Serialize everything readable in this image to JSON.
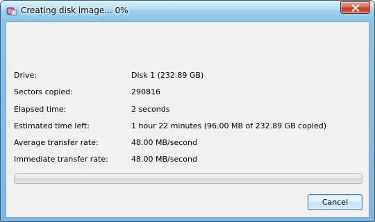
{
  "window": {
    "title": "Creating disk image... 0%",
    "title_icon": "disk-image-app-icon",
    "close_icon": "close-x-icon"
  },
  "details": [
    {
      "label": "Drive:",
      "value": "Disk 1 (232.89 GB)"
    },
    {
      "label": "Sectors copied:",
      "value": "290816"
    },
    {
      "label": "Elapsed time:",
      "value": "2 seconds"
    },
    {
      "label": "Estimated time left:",
      "value": "1 hour 22 minutes (96.00 MB of 232.89 GB copied)"
    },
    {
      "label": "Average transfer rate:",
      "value": "48.00 MB/second"
    },
    {
      "label": "Immediate transfer rate:",
      "value": "48.00 MB/second"
    }
  ],
  "progress": {
    "percent": 0
  },
  "buttons": {
    "cancel_label": "Cancel"
  },
  "colors": {
    "close_button": "#c4462f",
    "frame": "#87c5ea",
    "client_bg": "#f0f0f0"
  }
}
